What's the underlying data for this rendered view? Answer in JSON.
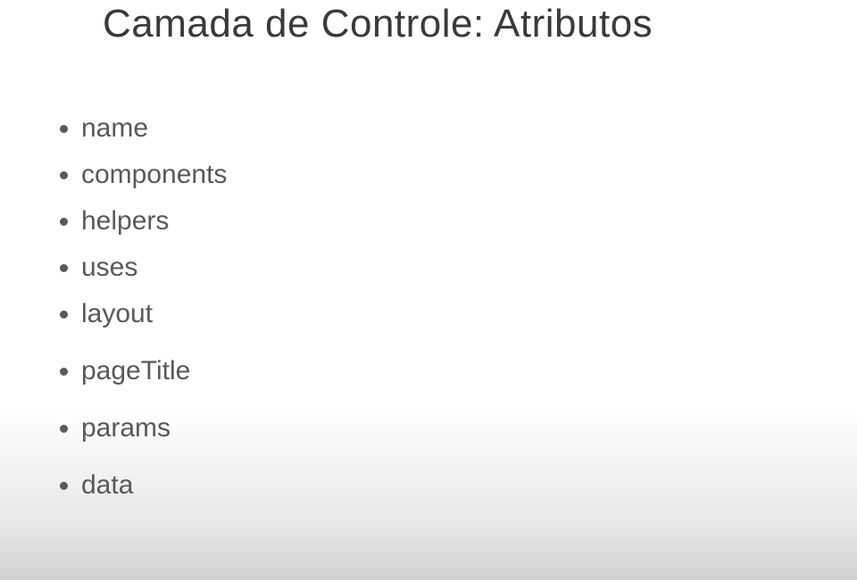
{
  "slide": {
    "title": "Camada de Controle: Atributos",
    "bullets": [
      {
        "text": "name",
        "gap": false
      },
      {
        "text": "components",
        "gap": false
      },
      {
        "text": "helpers",
        "gap": false
      },
      {
        "text": "uses",
        "gap": false
      },
      {
        "text": "layout",
        "gap": false
      },
      {
        "text": "pageTitle",
        "gap": true
      },
      {
        "text": "params",
        "gap": true
      },
      {
        "text": "data",
        "gap": true
      }
    ]
  }
}
